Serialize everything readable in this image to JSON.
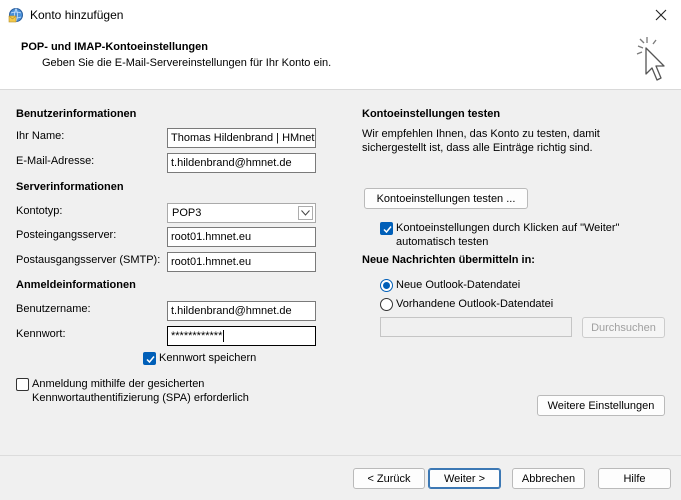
{
  "window": {
    "title": "Konto hinzufügen",
    "close_icon": "close-icon",
    "app_icon": "outlook-globe-icon"
  },
  "header": {
    "title": "POP- und IMAP-Kontoeinstellungen",
    "subtitle": "Geben Sie die E-Mail-Servereinstellungen für Ihr Konto ein."
  },
  "user_info": {
    "heading": "Benutzerinformationen",
    "name_label": "Ihr Name:",
    "name_value": "Thomas Hildenbrand | HMnet",
    "email_label": "E-Mail-Adresse:",
    "email_value": "t.hildenbrand@hmnet.de"
  },
  "server_info": {
    "heading": "Serverinformationen",
    "account_type_label": "Kontotyp:",
    "account_type_value": "POP3",
    "incoming_label": "Posteingangsserver:",
    "incoming_value": "root01.hmnet.eu",
    "outgoing_label": "Postausgangsserver (SMTP):",
    "outgoing_value": "root01.hmnet.eu"
  },
  "login_info": {
    "heading": "Anmeldeinformationen",
    "username_label": "Benutzername:",
    "username_value": "t.hildenbrand@hmnet.de",
    "password_label": "Kennwort:",
    "password_value": "************",
    "remember_password_label": "Kennwort speichern",
    "remember_password_checked": true,
    "spa_label_line1": "Anmeldung mithilfe der gesicherten",
    "spa_label_line2": "Kennwortauthentifizierung (SPA) erforderlich",
    "spa_checked": false
  },
  "test_settings": {
    "heading": "Kontoeinstellungen testen",
    "desc_line1": "Wir empfehlen Ihnen, das Konto zu testen, damit",
    "desc_line2": "sichergestellt ist, dass alle Einträge richtig sind.",
    "test_button": "Kontoeinstellungen testen ...",
    "auto_test_line1": "Kontoeinstellungen durch Klicken auf \"Weiter\"",
    "auto_test_line2": "automatisch testen",
    "auto_test_checked": true
  },
  "deliver": {
    "heading": "Neue Nachrichten übermitteln in:",
    "option_new": "Neue Outlook-Datendatei",
    "option_existing": "Vorhandene Outlook-Datendatei",
    "selected": "new",
    "path_value": "",
    "browse_button": "Durchsuchen"
  },
  "more_settings_button": "Weitere Einstellungen",
  "footer": {
    "back": "< Zurück",
    "next": "Weiter >",
    "cancel": "Abbrechen",
    "help": "Hilfe"
  }
}
